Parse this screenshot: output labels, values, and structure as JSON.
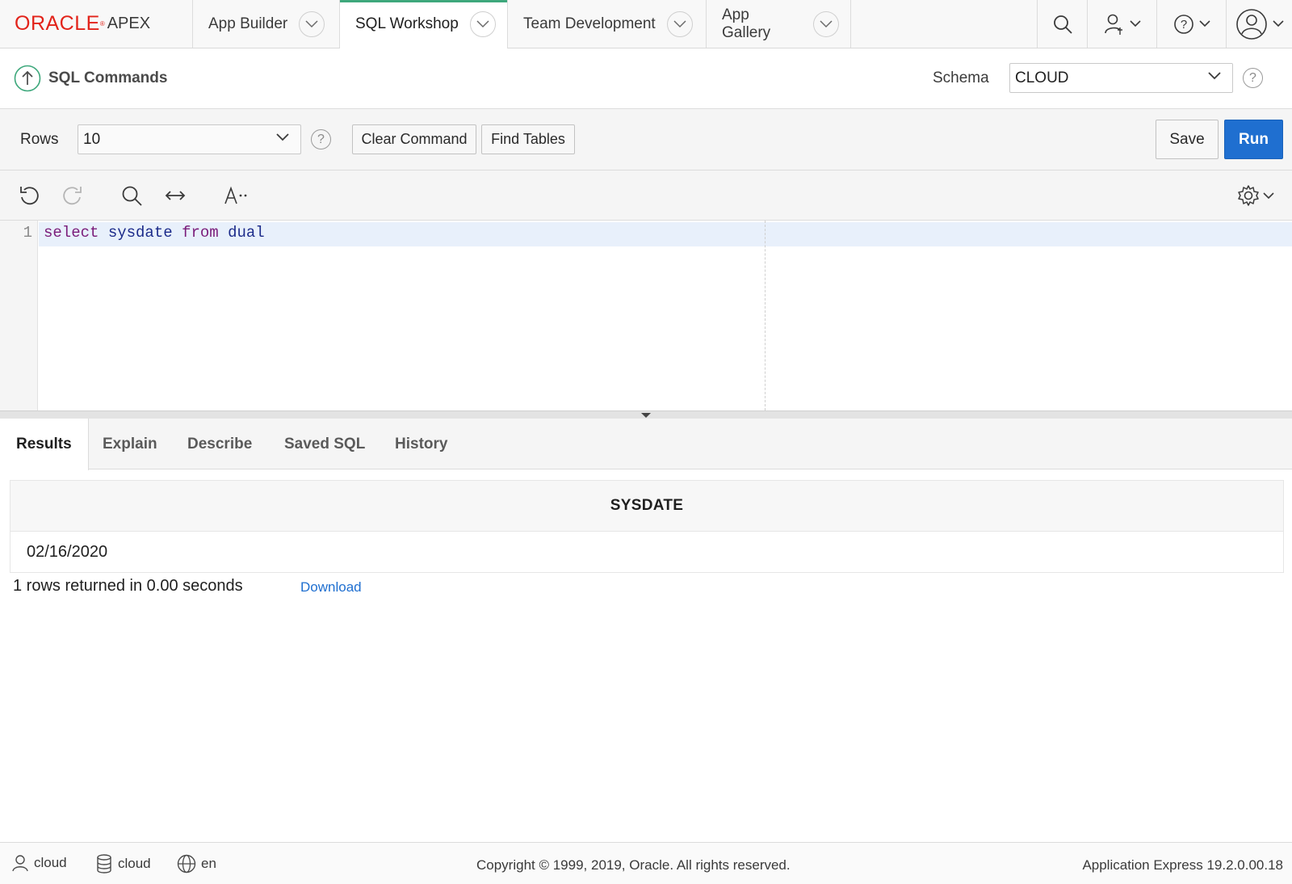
{
  "brand": {
    "oracle": "ORACLE",
    "reg": "®",
    "apex": "APEX"
  },
  "nav": {
    "tabs": [
      {
        "label": "App Builder"
      },
      {
        "label": "SQL Workshop"
      },
      {
        "label": "Team Development"
      },
      {
        "label": "App Gallery"
      }
    ],
    "active_tab": "SQL Workshop"
  },
  "title_bar": {
    "page_title": "SQL Commands",
    "schema_label": "Schema",
    "schema_value": "CLOUD",
    "help_symbol": "?"
  },
  "command_bar": {
    "rows_label": "Rows",
    "rows_value": "10",
    "help_symbol": "?",
    "clear_command_label": "Clear Command",
    "find_tables_label": "Find Tables",
    "save_label": "Save",
    "run_label": "Run"
  },
  "editor": {
    "line_number": "1",
    "code_tokens": {
      "select": "select",
      "sysdate": "sysdate",
      "from": "from",
      "dual": "dual"
    }
  },
  "results_tabs": [
    {
      "label": "Results"
    },
    {
      "label": "Explain"
    },
    {
      "label": "Describe"
    },
    {
      "label": "Saved SQL"
    },
    {
      "label": "History"
    }
  ],
  "results": {
    "column_header": "SYSDATE",
    "cell_value": "02/16/2020",
    "rows_returned": "1 rows returned in 0.00 seconds",
    "download_label": "Download"
  },
  "footer": {
    "user": "cloud",
    "workspace": "cloud",
    "language": "en",
    "copyright": "Copyright © 1999, 2019, Oracle. All rights reserved.",
    "version": "Application Express 19.2.0.00.18"
  },
  "colors": {
    "oracle_red": "#e2231a",
    "active_tab_accent": "#3ea87c",
    "run_button": "#1f6fd0",
    "link": "#1f6fd0"
  }
}
